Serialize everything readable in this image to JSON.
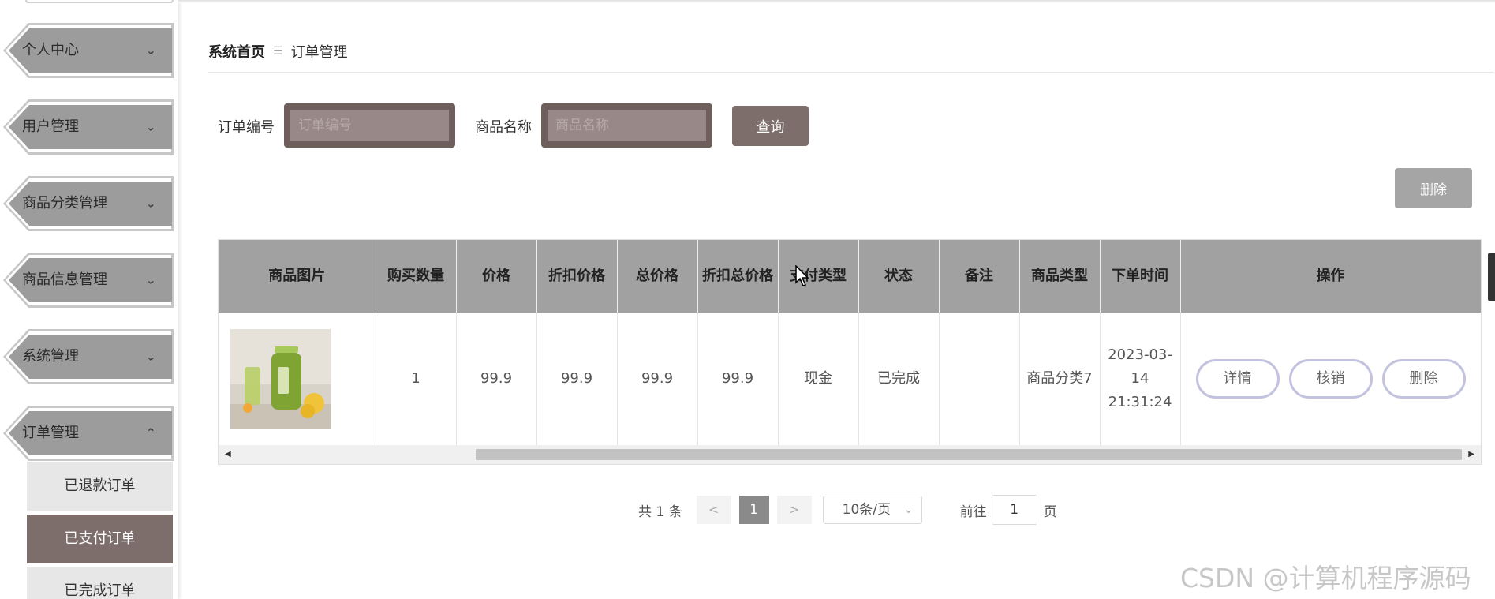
{
  "sidebar": {
    "menus": [
      {
        "label": "个人中心",
        "chevron": "chevron-down"
      },
      {
        "label": "用户管理",
        "chevron": "chevron-down"
      },
      {
        "label": "商品分类管理",
        "chevron": "chevron-down"
      },
      {
        "label": "商品信息管理",
        "chevron": "chevron-down"
      },
      {
        "label": "系统管理",
        "chevron": "chevron-down"
      },
      {
        "label": "订单管理",
        "chevron": "chevron-up"
      }
    ],
    "submenu": [
      {
        "label": "已退款订单",
        "active": false
      },
      {
        "label": "已支付订单",
        "active": true
      },
      {
        "label": "已完成订单",
        "active": false
      }
    ]
  },
  "breadcrumb": {
    "home": "系统首页",
    "separator": "☰",
    "current": "订单管理"
  },
  "search": {
    "order_no_label": "订单编号",
    "order_no_placeholder": "订单编号",
    "product_name_label": "商品名称",
    "product_name_placeholder": "商品名称",
    "query_button": "查询"
  },
  "toolbar": {
    "delete_button": "删除"
  },
  "table": {
    "headers": [
      "商品图片",
      "购买数量",
      "价格",
      "折扣价格",
      "总价格",
      "折扣总价格",
      "支付类型",
      "状态",
      "备注",
      "商品类型",
      "下单时间",
      "操作"
    ],
    "rows": [
      {
        "image": "green juice bottle with lemon",
        "quantity": "1",
        "price": "99.9",
        "discount_price": "99.9",
        "total_price": "99.9",
        "discount_total": "99.9",
        "pay_type": "现金",
        "status": "已完成",
        "remark": "",
        "category": "商品分类7",
        "order_time": "2023-03-14 21:31:24",
        "actions": {
          "detail": "详情",
          "verify": "核销",
          "delete": "删除"
        }
      }
    ]
  },
  "pagination": {
    "total": "共 1 条",
    "prev": "<",
    "current_page": "1",
    "next": ">",
    "page_size": "10条/页",
    "goto_label": "前往",
    "goto_value": "1",
    "page_suffix": "页"
  },
  "watermark": "CSDN @计算机程序源码",
  "colors": {
    "accent": "#7d6d6b",
    "menu": "#9c9c9c",
    "header": "#a1a1a1",
    "action_border": "#c3c3df"
  }
}
